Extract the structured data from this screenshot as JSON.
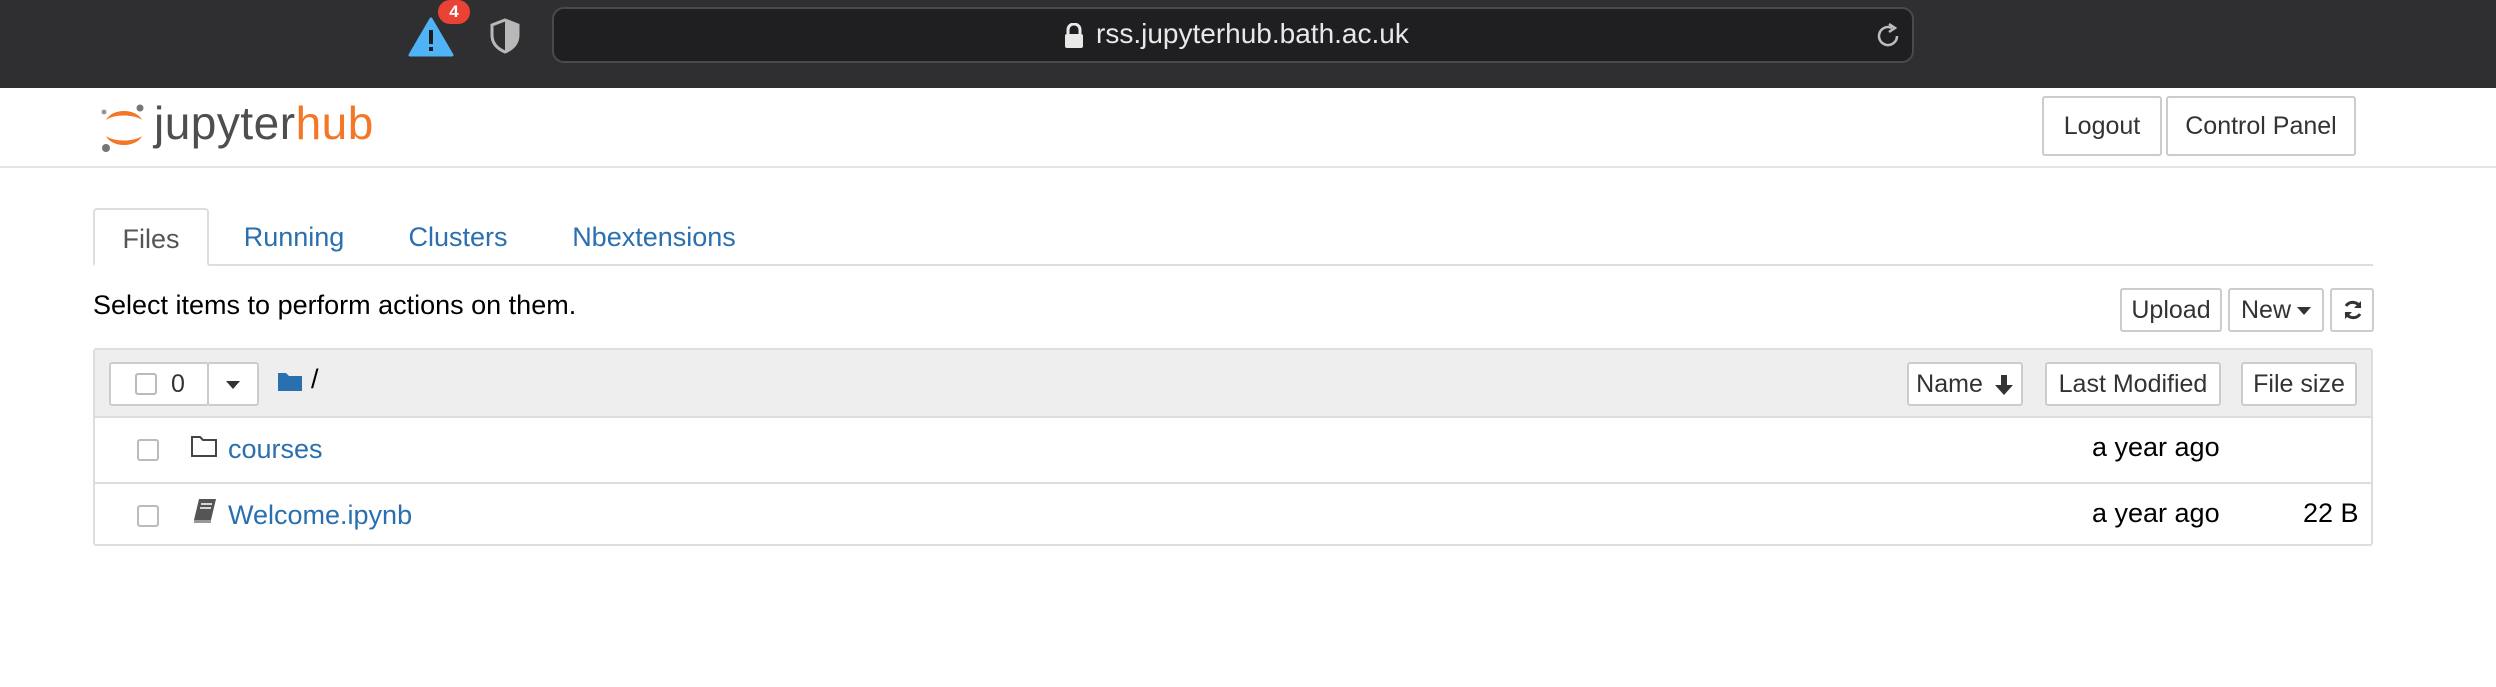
{
  "browser": {
    "url": "rss.jupyterhub.bath.ac.uk",
    "warning_count": "4"
  },
  "header": {
    "logo_primary": "jupyter",
    "logo_secondary": "hub",
    "logout_label": "Logout",
    "control_panel_label": "Control Panel"
  },
  "tabs": [
    {
      "label": "Files",
      "active": true
    },
    {
      "label": "Running",
      "active": false
    },
    {
      "label": "Clusters",
      "active": false
    },
    {
      "label": "Nbextensions",
      "active": false
    }
  ],
  "toolbar": {
    "hint": "Select items to perform actions on them.",
    "upload_label": "Upload",
    "new_label": "New"
  },
  "list_header": {
    "selected_count": "0",
    "path": "/",
    "sort_name_label": "Name",
    "last_modified_label": "Last Modified",
    "file_size_label": "File size"
  },
  "files": [
    {
      "name": "courses",
      "type": "folder",
      "modified": "a year ago",
      "size": ""
    },
    {
      "name": "Welcome.ipynb",
      "type": "notebook",
      "modified": "a year ago",
      "size": "22 B"
    }
  ],
  "colors": {
    "link": "#2a6fb0",
    "brand_orange": "#f37726",
    "warning_blue": "#4fb3f6",
    "badge_red": "#ea4335"
  }
}
